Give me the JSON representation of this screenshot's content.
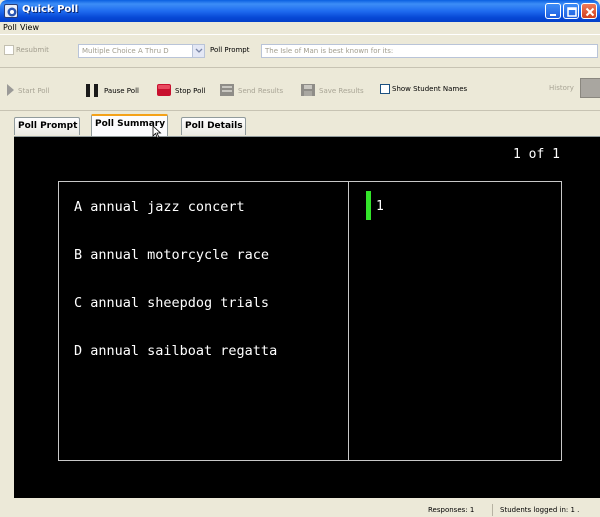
{
  "window": {
    "title": "Quick Poll"
  },
  "menu": [
    "Poll",
    "View"
  ],
  "settings": {
    "resubmit_label": "Resubmit",
    "question_type": "Multiple Choice A Thru D",
    "prompt_label": "Poll Prompt",
    "prompt_text": "The Isle of Man is best known for its:"
  },
  "toolbar": {
    "start": "Start Poll",
    "pause": "Pause Poll",
    "stop": "Stop Poll",
    "send": "Send Results",
    "save": "Save Results",
    "show_names": "Show Student Names",
    "history": "History"
  },
  "tabs": [
    "Poll Prompt",
    "Poll Summary",
    "Poll Details"
  ],
  "active_tab": "Poll Summary",
  "summary": {
    "page_indicator": "1 of 1",
    "answers": [
      {
        "text": "A annual jazz concert",
        "count": "1"
      },
      {
        "text": "B annual motorcycle race",
        "count": ""
      },
      {
        "text": "C annual sheepdog trials",
        "count": ""
      },
      {
        "text": "D annual sailboat regatta",
        "count": ""
      }
    ]
  },
  "status": {
    "responses": "Responses: 1",
    "logged_in": "Students logged in: 1 ."
  },
  "colors": {
    "title_bar": "#0a5fe0",
    "result_bar": "#33e52a",
    "active_tab_accent": "#f4a21a",
    "display_background": "#000000"
  }
}
